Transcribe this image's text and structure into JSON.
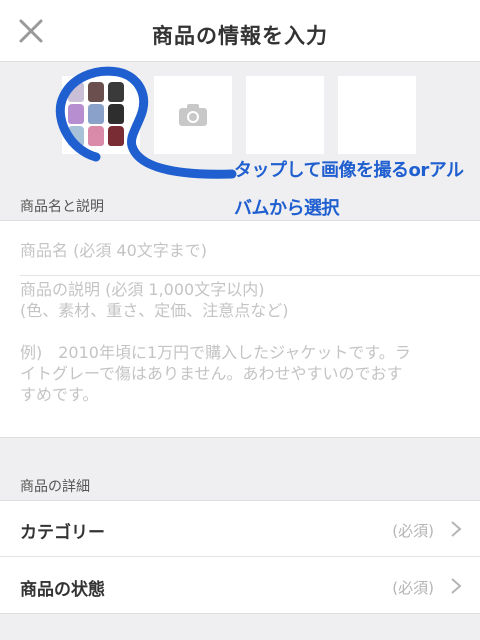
{
  "header": {
    "title": "商品の情報を入力"
  },
  "photos": {
    "slots": [
      "thumbnail",
      "camera",
      "empty",
      "empty"
    ]
  },
  "annotation": {
    "line1": "タップして画像を撮るorアル",
    "line2": "バムから選択",
    "color": "#1f5fd0"
  },
  "name_section": {
    "label": "商品名と説明",
    "name_placeholder": "商品名 (必須 40文字まで)",
    "desc_lines": [
      "商品の説明 (必須 1,000文字以内)",
      "(色、素材、重さ、定価、注意点など)",
      "",
      "例)　2010年頃に1万円で購入したジャケットです。ラ",
      "イトグレーで傷はありません。あわせやすいのでおす",
      "すめです。"
    ]
  },
  "detail_section": {
    "label": "商品の詳細",
    "rows": [
      {
        "label": "カテゴリー",
        "required": "(必須)"
      },
      {
        "label": "商品の状態",
        "required": "(必須)"
      }
    ]
  },
  "icons": {
    "close": "close-icon",
    "camera": "camera-icon",
    "chevron": "chevron-right-icon"
  }
}
